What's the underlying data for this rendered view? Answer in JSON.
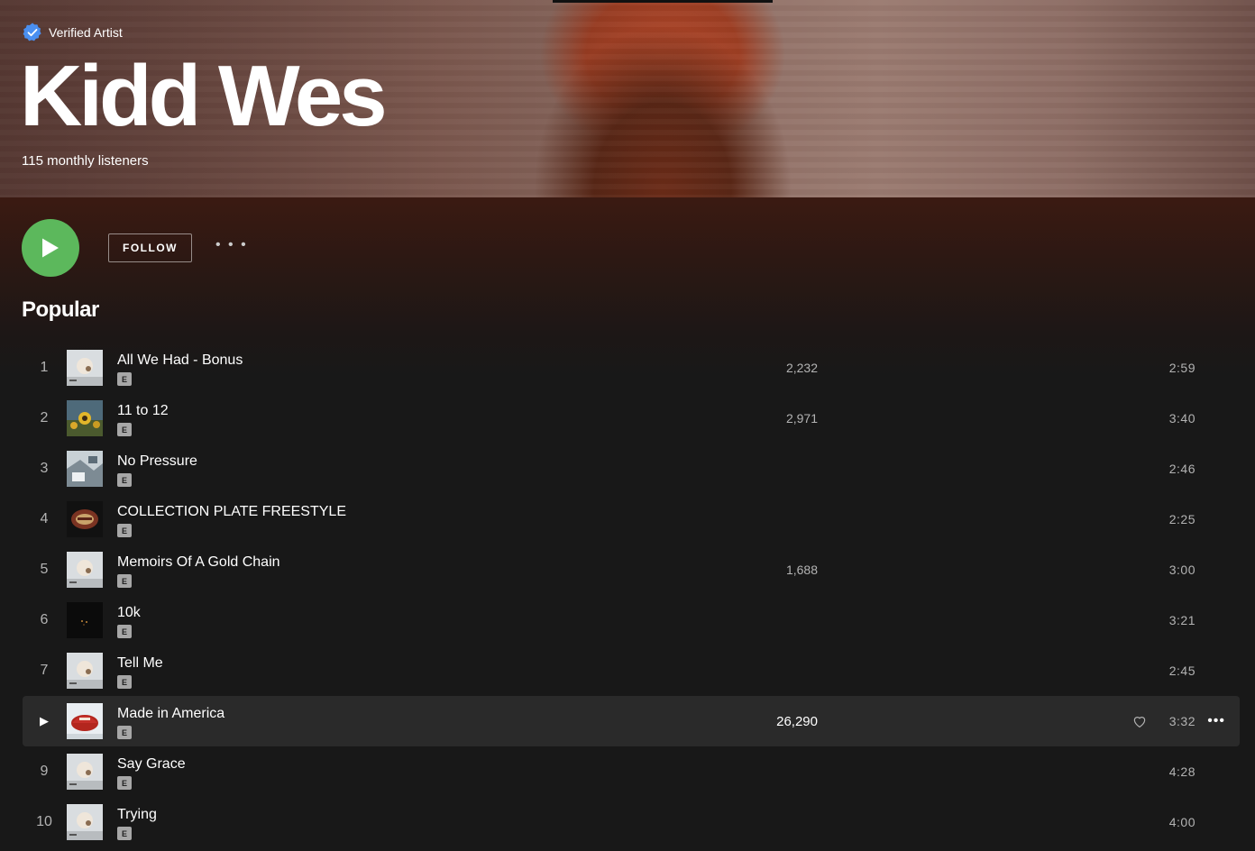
{
  "artist": {
    "verified_label": "Verified Artist",
    "name": "Kidd Wes",
    "listeners": "115 monthly listeners"
  },
  "controls": {
    "play_icon": "play-icon",
    "follow_label": "FOLLOW",
    "more_label": "• • •"
  },
  "popular": {
    "title": "Popular",
    "tracks": [
      {
        "num": "1",
        "title": "All We Had - Bonus",
        "explicit": "E",
        "plays": "2,232",
        "duration": "2:59",
        "art": "white-cover"
      },
      {
        "num": "2",
        "title": "11 to 12",
        "explicit": "E",
        "plays": "2,971",
        "duration": "3:40",
        "art": "sunflower-cover"
      },
      {
        "num": "3",
        "title": "No Pressure",
        "explicit": "E",
        "plays": "",
        "duration": "2:46",
        "art": "light-collage-cover"
      },
      {
        "num": "4",
        "title": "COLLECTION PLATE FREESTYLE",
        "explicit": "E",
        "plays": "",
        "duration": "2:25",
        "art": "dark-plate-cover"
      },
      {
        "num": "5",
        "title": "Memoirs Of A Gold Chain",
        "explicit": "E",
        "plays": "1,688",
        "duration": "3:00",
        "art": "white-cover"
      },
      {
        "num": "6",
        "title": "10k",
        "explicit": "E",
        "plays": "",
        "duration": "3:21",
        "art": "black-cover"
      },
      {
        "num": "7",
        "title": "Tell Me",
        "explicit": "E",
        "plays": "",
        "duration": "2:45",
        "art": "white-cover"
      },
      {
        "num": "▶",
        "title": "Made in America",
        "explicit": "E",
        "plays": "26,290",
        "duration": "3:32",
        "art": "red-hat-cover",
        "hover": true,
        "more": "•••"
      },
      {
        "num": "9",
        "title": "Say Grace",
        "explicit": "E",
        "plays": "",
        "duration": "4:28",
        "art": "white-cover"
      },
      {
        "num": "10",
        "title": "Trying",
        "explicit": "E",
        "plays": "",
        "duration": "4:00",
        "art": "white-cover"
      }
    ]
  },
  "colors": {
    "play_green": "#5cb85c",
    "background": "#181818",
    "row_hover": "#2a2a2a",
    "muted_text": "#b3b3b3"
  }
}
